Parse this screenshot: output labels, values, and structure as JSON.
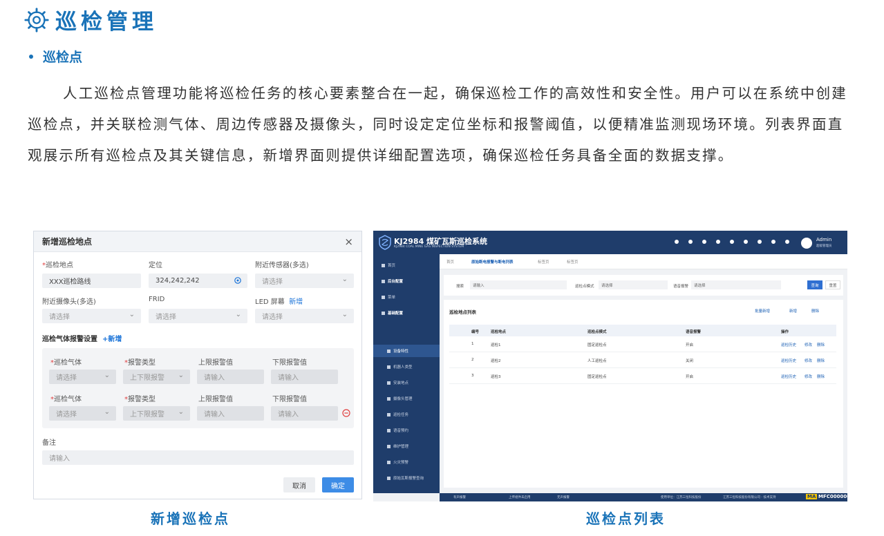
{
  "header": {
    "title": "巡检管理",
    "subtitle": "巡检点",
    "paragraph": "人工巡检点管理功能将巡检任务的核心要素整合在一起，确保巡检工作的高效性和安全性。用户可以在系统中创建巡检点，并关联检测气体、周边传感器及摄像头，同时设定定位坐标和报警阈值，以便精准监测现场环境。列表界面直观展示所有巡检点及其关键信息，新增界面则提供详细配置选项，确保巡检任务具备全面的数据支撑。"
  },
  "dialog": {
    "title": "新增巡检地点",
    "close": "×",
    "f_location_label": "巡检地点",
    "f_location_value": "XXX巡检路线",
    "f_position_label": "定位",
    "f_position_value": "324,242,242",
    "f_sensor_label": "附近传感器(多选)",
    "f_sensor_ph": "请选择",
    "f_camera_label": "附近摄像头(多选)",
    "f_camera_ph": "请选择",
    "f_frid_label": "FRID",
    "f_frid_ph": "请选择",
    "f_led_label": "LED 屏幕",
    "f_led_add": "新增",
    "f_led_ph": "请选择",
    "gas_section": "巡检气体报警设置",
    "gas_add": "+新增",
    "gas_rows": [
      {
        "gas_label": "巡检气体",
        "gas_ph": "请选择",
        "type_label": "报警类型",
        "type_value": "上下限报警",
        "upper_label": "上限报警值",
        "upper_ph": "请输入",
        "lower_label": "下限报警值",
        "lower_ph": "请输入"
      },
      {
        "gas_label": "巡检气体",
        "gas_ph": "请选择",
        "type_label": "报警类型",
        "type_value": "上下限报警",
        "upper_label": "上限报警值",
        "upper_ph": "请输入",
        "lower_label": "下限报警值",
        "lower_ph": "请输入"
      }
    ],
    "remark_label": "备注",
    "remark_ph": "请输入",
    "cancel": "取消",
    "ok": "确定"
  },
  "app": {
    "system_name": "KJ2984 煤矿瓦斯巡检系统",
    "system_en": "KJ2984 COAL MINE GAS INSPECTION SYSTEM",
    "user": "Admin",
    "user_role": "超级管理员",
    "sidebar": [
      "首页",
      "后台配置",
      "菜单",
      "基础配置",
      "设备特性",
      "机器人类型",
      "安装地点",
      "摄像头管理",
      "巡检任务",
      "语音预约",
      "维护管理",
      "火灾预警",
      "原始瓦斯报警查询",
      "巡检点",
      "人工巡检任务",
      "机器人控制"
    ],
    "tabs": [
      "首页",
      "原始断电报警与断电列表",
      "标签页",
      "标签页"
    ],
    "filter": {
      "search_label": "搜索",
      "search_ph": "请输入",
      "mode_label": "巡检点模式",
      "mode_ph": "请选择",
      "voice_label": "语音报警",
      "voice_ph": "请选择",
      "query": "查询",
      "reset": "重置"
    },
    "list_title": "巡检地点列表",
    "actions": [
      "批量新增",
      "新增",
      "删除"
    ],
    "columns": [
      "编号",
      "巡检地点",
      "巡检点模式",
      "语音报警",
      "操作"
    ],
    "rows": [
      {
        "no": "1",
        "name": "巡检1",
        "mode": "固定巡检点",
        "voice": "开启"
      },
      {
        "no": "2",
        "name": "巡检2",
        "mode": "人工巡检点",
        "voice": "关闭"
      },
      {
        "no": "3",
        "name": "巡检3",
        "mode": "固定巡检点",
        "voice": "开启"
      }
    ],
    "row_ops": [
      "巡检历史",
      "修改",
      "删除"
    ],
    "statusbar": {
      "left": [
        "有声报警",
        "上传组件未启用",
        "无声报警"
      ],
      "unit": "使用单位：江苏三恒科技股份",
      "vendor": "江苏三恒科技股份有限公司 - 技术支持",
      "ma": "MA",
      "code": "MFC000000"
    }
  },
  "captions": {
    "left": "新增巡检点",
    "right": "巡检点列表"
  }
}
